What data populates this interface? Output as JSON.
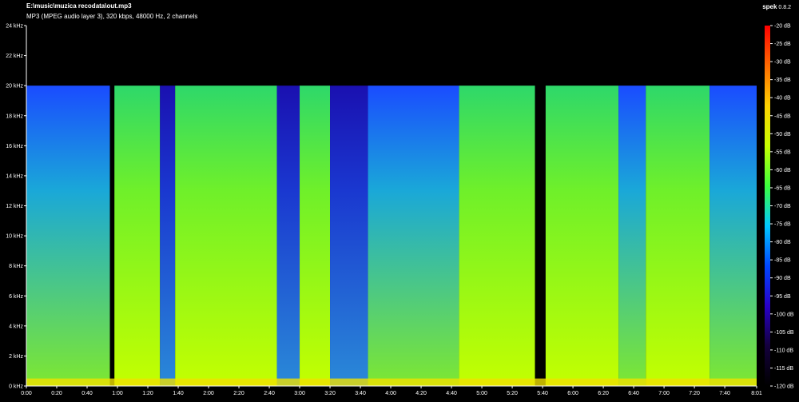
{
  "header": {
    "file_path": "E:\\music\\muzica recodata\\out.mp3",
    "file_info": "MP3 (MPEG audio layer 3), 320 kbps, 48000 Hz, 2 channels",
    "app_name": "spek",
    "app_version": "0.8.2"
  },
  "chart_data": {
    "type": "heatmap",
    "title": "",
    "x_axis": {
      "ticks": [
        "0:00",
        "0:20",
        "0:40",
        "1:00",
        "1:20",
        "1:40",
        "2:00",
        "2:20",
        "2:40",
        "3:00",
        "3:20",
        "3:40",
        "4:00",
        "4:20",
        "4:40",
        "5:00",
        "5:20",
        "5:40",
        "6:00",
        "6:20",
        "6:40",
        "7:00",
        "7:20",
        "7:40",
        "8:01"
      ],
      "range": [
        "0:00",
        "8:01"
      ]
    },
    "y_axis": {
      "ticks": [
        "0 kHz",
        "2 kHz",
        "4 kHz",
        "6 kHz",
        "8 kHz",
        "10 kHz",
        "12 kHz",
        "14 kHz",
        "16 kHz",
        "18 kHz",
        "20 kHz",
        "22 kHz",
        "24 kHz"
      ],
      "range": [
        0,
        24
      ]
    },
    "color_scale": {
      "ticks": [
        "-20 dB",
        "-25 dB",
        "-30 dB",
        "-35 dB",
        "-40 dB",
        "-45 dB",
        "-50 dB",
        "-55 dB",
        "-60 dB",
        "-65 dB",
        "-70 dB",
        "-75 dB",
        "-80 dB",
        "-85 dB",
        "-90 dB",
        "-95 dB",
        "-100 dB",
        "-105 dB",
        "-110 dB",
        "-115 dB",
        "-120 dB"
      ],
      "range": [
        -120,
        -20
      ],
      "colors": [
        "#ff0000",
        "#ff6a00",
        "#ffd200",
        "#c8ff00",
        "#3cff3c",
        "#00c8ff",
        "#0046ff",
        "#2800c8",
        "#14003c",
        "#000000"
      ]
    },
    "lowpass_cutoff_khz": 20,
    "segments": [
      {
        "start": "0:00",
        "end": "0:55",
        "level": "mid"
      },
      {
        "start": "0:55",
        "end": "0:58",
        "level": "gap"
      },
      {
        "start": "0:58",
        "end": "1:28",
        "level": "high"
      },
      {
        "start": "1:28",
        "end": "1:38",
        "level": "low"
      },
      {
        "start": "1:38",
        "end": "2:45",
        "level": "high"
      },
      {
        "start": "2:45",
        "end": "3:00",
        "level": "low"
      },
      {
        "start": "3:00",
        "end": "3:20",
        "level": "high"
      },
      {
        "start": "3:20",
        "end": "3:45",
        "level": "low"
      },
      {
        "start": "3:45",
        "end": "4:45",
        "level": "mid"
      },
      {
        "start": "4:45",
        "end": "5:35",
        "level": "high"
      },
      {
        "start": "5:35",
        "end": "5:42",
        "level": "gap"
      },
      {
        "start": "5:42",
        "end": "6:30",
        "level": "high"
      },
      {
        "start": "6:30",
        "end": "6:48",
        "level": "mid"
      },
      {
        "start": "6:48",
        "end": "7:30",
        "level": "high"
      },
      {
        "start": "7:30",
        "end": "8:01",
        "level": "mid"
      }
    ]
  }
}
